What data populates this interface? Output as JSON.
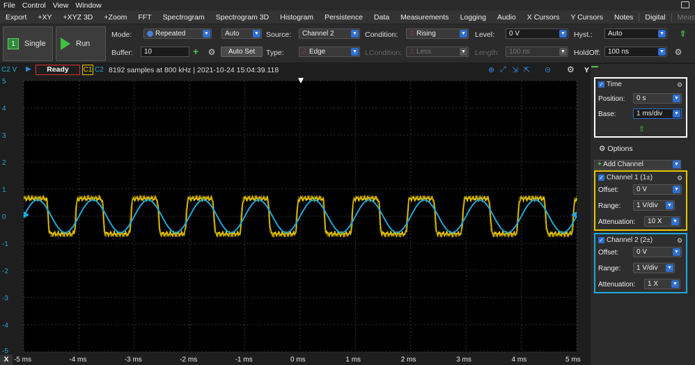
{
  "menu": [
    "File",
    "Control",
    "View",
    "Window"
  ],
  "toolbar": [
    "Export",
    "+XY",
    "+XYZ 3D",
    "+Zoom",
    "FFT",
    "Spectrogram",
    "Spectrogram 3D",
    "Histogram",
    "Persistence",
    "Data",
    "Measurements",
    "Logging",
    "Audio",
    "X Cursors",
    "Y Cursors",
    "Notes",
    "Digital",
    "Measurements"
  ],
  "controls": {
    "single_label": "Single",
    "run_label": "Run",
    "mode_label": "Mode:",
    "mode_value": "Repeated",
    "mode2_value": "Auto",
    "source_label": "Source:",
    "source_value": "Channel 2",
    "condition_label": "Condition:",
    "condition_value": "Rising",
    "level_label": "Level:",
    "level_value": "0 V",
    "hyst_label": "Hyst.:",
    "hyst_value": "Auto",
    "buffer_label": "Buffer:",
    "buffer_value": "10",
    "autoset_label": "Auto Set",
    "type_label": "Type:",
    "type_value": "Edge",
    "lcondition_label": "LCondition:",
    "lcondition_value": "Less",
    "length_label": "Length:",
    "length_value": "100 ns",
    "holdoff_label": "HoldOff:",
    "holdoff_value": "100 ns"
  },
  "status": {
    "axis_label": "C2 V",
    "state": "Ready",
    "c1": "C1",
    "c2": "C2",
    "info": "8192 samples at 800 kHz | 2021-10-24 15:04:39.118",
    "y_label": "Y"
  },
  "y_ticks": [
    "5",
    "4",
    "3",
    "2",
    "1",
    "0",
    "-1",
    "-2",
    "-3",
    "-4",
    "-5"
  ],
  "x_axis_label": "X",
  "x_ticks": [
    "-5 ms",
    "-4 ms",
    "-3 ms",
    "-2 ms",
    "-1 ms",
    "0 ms",
    "1 ms",
    "2 ms",
    "3 ms",
    "4 ms",
    "5 ms"
  ],
  "time_panel": {
    "title": "Time",
    "position_label": "Position:",
    "position_value": "0 s",
    "base_label": "Base:",
    "base_value": "1 ms/div"
  },
  "options_label": "Options",
  "add_channel_label": "Add Channel",
  "ch1": {
    "title": "Channel 1 (1±)",
    "offset_label": "Offset:",
    "offset_value": "0 V",
    "range_label": "Range:",
    "range_value": "1 V/div",
    "atten_label": "Attenuation:",
    "atten_value": "10 X",
    "color": "#e8c800"
  },
  "ch2": {
    "title": "Channel 2 (2±)",
    "offset_label": "Offset:",
    "offset_value": "0 V",
    "range_label": "Range:",
    "range_value": "1 V/div",
    "atten_label": "Attenuation:",
    "atten_value": "1 X",
    "color": "#1fa8dc"
  },
  "signals": {
    "square_amplitude_v": 0.65,
    "sine_amplitude_v": 0.6,
    "period_ms": 1.0
  }
}
